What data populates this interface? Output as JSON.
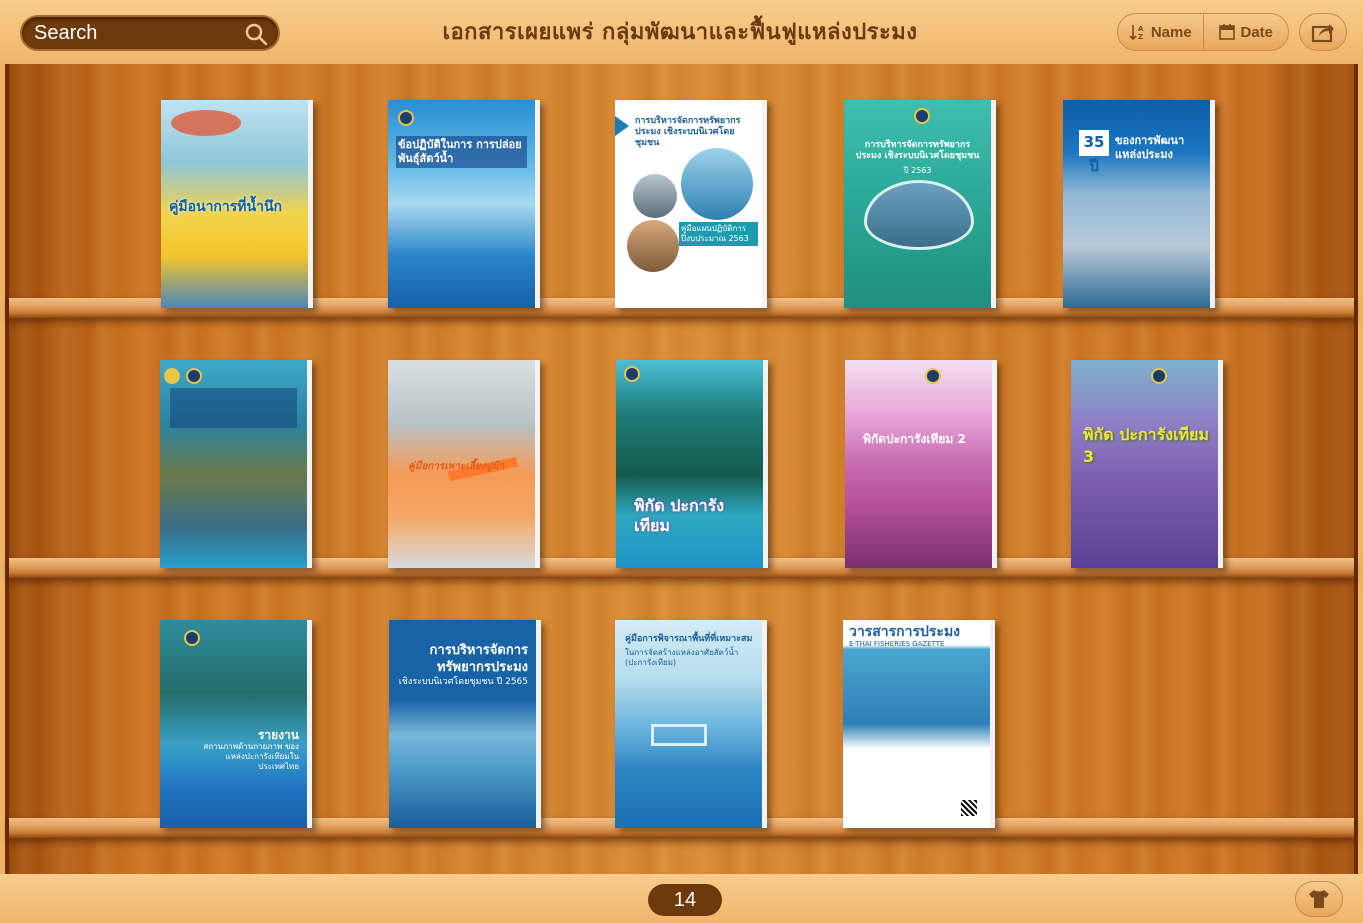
{
  "header": {
    "search_placeholder": "Search",
    "title": "เอกสารเผยแพร่ กลุ่มพัฒนาและฟื้นฟูแหล่งประมง",
    "sort_name_label": "Name",
    "sort_date_label": "Date"
  },
  "books": [
    {
      "title": "คู่มือนาการที่น้ำนึก",
      "subtitle": ""
    },
    {
      "title": "ข้อปฏิบัติในการ การปล่อยพันธุ์สัตว์น้ำ",
      "subtitle": ""
    },
    {
      "title": "การบริหารจัดการทรัพยากรประมง เชิงระบบนิเวศโดยชุมชน",
      "subtitle": "คู่มือแผนปฏิบัติการ ปีงบประมาณ 2563"
    },
    {
      "title": "การบริหารจัดการทรัพยากรประมง เชิงระบบนิเวศโดยชุมชน",
      "subtitle": "ปี 2563"
    },
    {
      "title": "ของการพัฒนา แหล่งประมง",
      "subtitle": "35 ปี"
    },
    {
      "title": "",
      "subtitle": ""
    },
    {
      "title": "คู่มือการเพาะเลี้ยงปูม้า",
      "subtitle": ""
    },
    {
      "title": "พิกัด ปะการังเทียม",
      "subtitle": ""
    },
    {
      "title": "พิกัดปะการังเทียม 2",
      "subtitle": ""
    },
    {
      "title": "พิกัด ปะการังเทียม 3",
      "subtitle": ""
    },
    {
      "title": "รายงาน",
      "subtitle": "สถานภาพด้านกายภาพ ของแหล่งปะการังเทียมในประเทศไทย"
    },
    {
      "title": "การบริหารจัดการ ทรัพยากรประมง",
      "subtitle": "เชิงระบบนิเวศโดยชุมชน ปี 2565"
    },
    {
      "title": "คู่มือการพิจารณาพื้นที่ที่เหมาะสม",
      "subtitle": "ในการจัดสร้างแหล่งอาศัยสัตว์น้ำ (ปะการังเทียม)"
    },
    {
      "title": "วารสารการประมง",
      "subtitle": "E-THAI FISHERIES GAZETTE"
    }
  ],
  "footer": {
    "page_count": "14"
  },
  "colors": {
    "wood_light": "#f0b56c",
    "wood_dark": "#6e3a0c",
    "title_text": "#6b3a10"
  }
}
